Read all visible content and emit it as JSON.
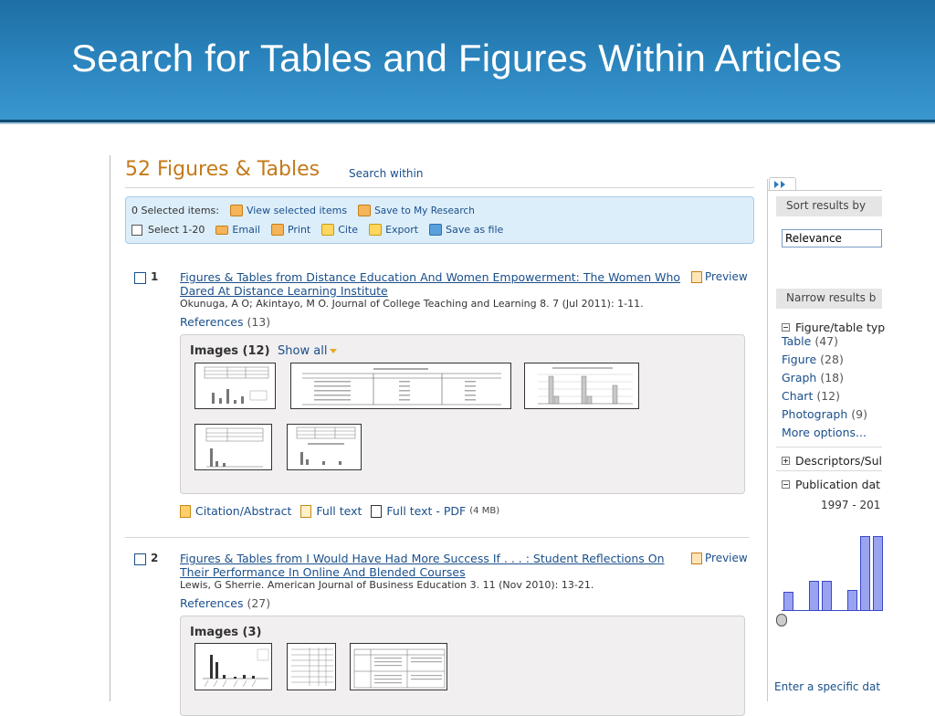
{
  "slide_title": "Search for Tables and Figures Within Articles",
  "results_header": {
    "count_title": "52 Figures & Tables",
    "search_within": "Search within"
  },
  "toolbar": {
    "selected": "0 Selected items:",
    "view_selected": "View selected items",
    "save_research": "Save to My Research",
    "select_range": "Select 1-20",
    "email": "Email",
    "print": "Print",
    "cite": "Cite",
    "export": "Export",
    "save_file": "Save as file"
  },
  "results": [
    {
      "num": "1",
      "title": "Figures & Tables from Distance Education And Women Empowerment: The Women Who Dared At Distance Learning Institute",
      "preview": "Preview",
      "meta": "Okunuga, A O; Akintayo, M O. Journal of College Teaching and Learning 8. 7  (Jul 2011): 1-11.",
      "refs_label": "References",
      "refs_count": "(13)",
      "images_label": "Images (12)",
      "show_all": "Show all",
      "links": {
        "citation": "Citation/Abstract",
        "fulltext": "Full text",
        "pdf": "Full text - PDF",
        "pdf_size": "(4 MB)"
      }
    },
    {
      "num": "2",
      "title": "Figures & Tables from I Would Have Had More Success If . . . : Student Reflections On Their Performance In Online And Blended Courses",
      "preview": "Preview",
      "meta": "Lewis, G Sherrie. American Journal of Business Education 3. 11  (Nov 2010): 13-21.",
      "refs_label": "References",
      "refs_count": "(27)",
      "images_label": "Images (3)"
    }
  ],
  "sidebar": {
    "sort_header": "Sort results by",
    "sort_value": "Relevance",
    "narrow_header": "Narrow results b",
    "figure_type": {
      "heading": "Figure/table typ",
      "items": [
        {
          "label": "Table",
          "count": "(47)"
        },
        {
          "label": "Figure",
          "count": "(28)"
        },
        {
          "label": "Graph",
          "count": "(18)"
        },
        {
          "label": "Chart",
          "count": "(12)"
        },
        {
          "label": "Photograph",
          "count": "(9)"
        }
      ],
      "more": "More options..."
    },
    "descriptors": "Descriptors/Sul",
    "pub_date": "Publication dat",
    "date_range": "1997 - 201",
    "histogram_levels": [
      0.25,
      0,
      0.4,
      0.4,
      0,
      0.28,
      1.0,
      1.0
    ],
    "enter_date": "Enter a specific dat"
  },
  "colors": {
    "banner": "#2c86bf",
    "title_orange": "#c47a1a",
    "link_blue": "#1a4f8b",
    "toolbar_bg": "#dceef9",
    "hist_fill": "#9aa3f0"
  }
}
